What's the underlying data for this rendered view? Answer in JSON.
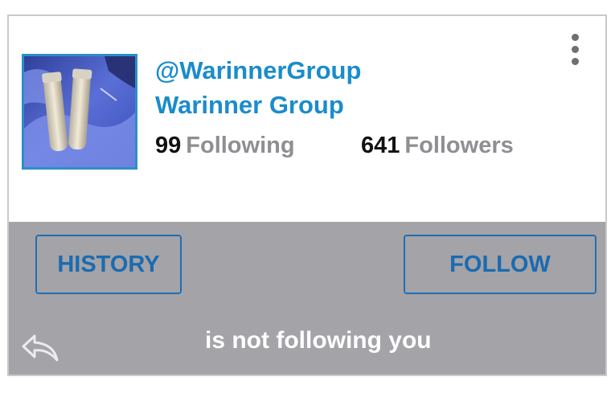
{
  "profile": {
    "handle": "@WarinnerGroup",
    "display_name": "Warinner Group",
    "following_count": "99",
    "following_label": "Following",
    "followers_count": "641",
    "followers_label": "Followers",
    "avatar_icon": "sample-tubes-in-gloved-hand"
  },
  "menu": {
    "icon": "vertical-ellipsis-icon"
  },
  "actions": {
    "history_label": "HISTORY",
    "follow_label": "FOLLOW",
    "reply_icon": "reply-arrow-icon"
  },
  "status_text": "is not following you",
  "colors": {
    "accent": "#1a8ccc",
    "button_border": "#1f6fb2",
    "bottom_panel": "#a3a3a8",
    "muted_text": "#8e8e93"
  }
}
